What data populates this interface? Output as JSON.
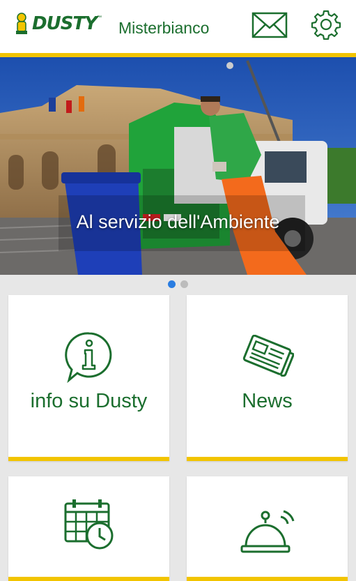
{
  "header": {
    "logo_text": "DUSTY",
    "logo_tm": "™",
    "city": "Misterbianco",
    "mail_icon": "envelope-icon",
    "settings_icon": "gear-icon"
  },
  "banner": {
    "caption": "Al servizio dell'Ambiente",
    "slides_total": 2,
    "active_slide": 1
  },
  "tiles": [
    {
      "label": "info su Dusty",
      "icon": "info-icon"
    },
    {
      "label": "News",
      "icon": "newspaper-icon"
    },
    {
      "label": "",
      "icon": "calendar-clock-icon"
    },
    {
      "label": "",
      "icon": "service-bell-icon"
    }
  ],
  "colors": {
    "brand_green": "#1b6e2e",
    "accent_yellow": "#f2c400",
    "pager_active": "#2a7de1"
  }
}
